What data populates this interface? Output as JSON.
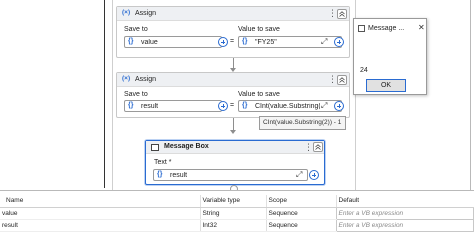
{
  "assign1": {
    "title": "Assign",
    "save_to_label": "Save to",
    "value_to_save_label": "Value to save",
    "save_to_value": "value",
    "value_to_save_value": "\"FY25\""
  },
  "assign2": {
    "title": "Assign",
    "save_to_label": "Save to",
    "value_to_save_label": "Value to save",
    "save_to_value": "result",
    "value_to_save_value": "CInt(value.Substring(2))",
    "tooltip": "CInt(value.Substring(2)) - 1"
  },
  "message_box_activity": {
    "title": "Message Box",
    "text_label": "Text *",
    "text_value": "result"
  },
  "dialog": {
    "title": "Message ...",
    "message": "24",
    "ok_label": "OK"
  },
  "variables": {
    "headers": [
      "Name",
      "Variable type",
      "Scope",
      "Default"
    ],
    "rows": [
      {
        "name": "value",
        "type": "String",
        "scope": "Sequence",
        "default": "Enter a VB expression"
      },
      {
        "name": "result",
        "type": "Int32",
        "scope": "Sequence",
        "default": "Enter a VB expression"
      }
    ]
  },
  "icons": {
    "assign": "assign-x-icon",
    "expression": "curly-braces-icon",
    "add": "plus-circle-icon",
    "expand": "expand-arrows-icon",
    "kebab": "more-vertical-icon",
    "collapse": "chevron-up-double-icon",
    "message_box": "message-box-icon",
    "close": "close-icon"
  },
  "colors": {
    "accent": "#2a6bd1",
    "header_bg": "#eef0f3"
  }
}
